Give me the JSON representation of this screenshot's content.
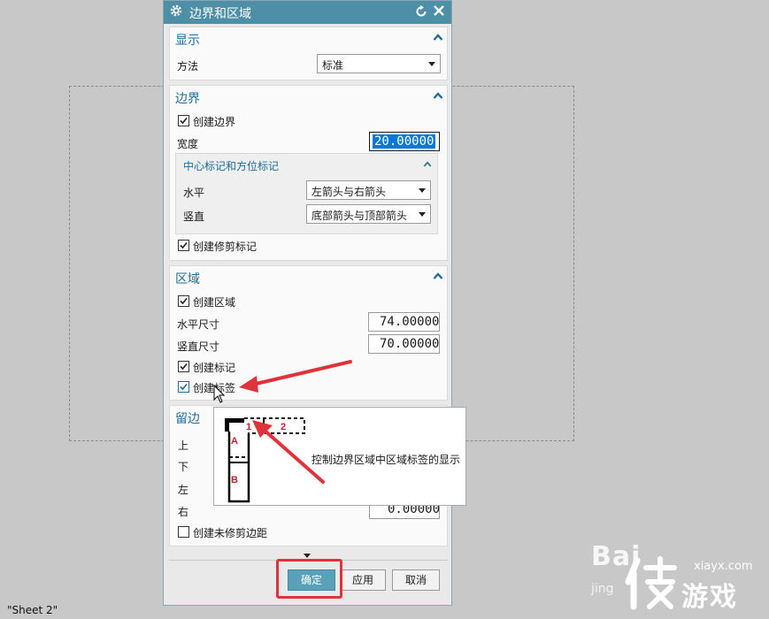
{
  "sheet": {
    "label": "\"Sheet 2\""
  },
  "dialog": {
    "title": "边界和区域",
    "icons": {
      "gear": "gear-icon",
      "reset": "reset-icon",
      "close": "close-icon"
    },
    "display": {
      "title": "显示",
      "method_label": "方法",
      "method_value": "标准"
    },
    "border": {
      "title": "边界",
      "create_border_label": "创建边界",
      "create_border_checked": true,
      "width_label": "宽度",
      "width_value": "20.00000",
      "markers": {
        "title": "中心标记和方位标记",
        "horizontal_label": "水平",
        "horizontal_value": "左箭头与右箭头",
        "vertical_label": "竖直",
        "vertical_value": "底部箭头与顶部箭头"
      },
      "create_trim_label": "创建修剪标记",
      "create_trim_checked": true
    },
    "zones": {
      "title": "区域",
      "create_zones_label": "创建区域",
      "create_zones_checked": true,
      "horizontal_size_label": "水平尺寸",
      "horizontal_size_value": "74.00000",
      "vertical_size_label": "竖直尺寸",
      "vertical_size_value": "70.00000",
      "create_marks_label": "创建标记",
      "create_marks_checked": true,
      "create_labels_label": "创建标签",
      "create_labels_checked": true
    },
    "margins": {
      "title": "留边",
      "top_label": "上",
      "bottom_label": "下",
      "left_label": "左",
      "right_label": "右",
      "right_value": "0.00000",
      "untrimmed_label": "创建未修剪边距",
      "untrimmed_checked": false
    },
    "buttons": {
      "ok": "确定",
      "apply": "应用",
      "cancel": "取消"
    }
  },
  "tooltip": {
    "text": "控制边界区域中区域标签的显示",
    "figure_labels": {
      "a": "A",
      "b": "B",
      "one": "1",
      "two": "2"
    }
  },
  "watermark": {
    "baidu": "Bai",
    "jingyan": "jing",
    "site": "xiayx.com",
    "brand": "游戏"
  },
  "colors": {
    "titlebar": "#4e8fa8",
    "section_title": "#1c6e9a",
    "annotation_red": "#e0323a",
    "selection": "#0078d7"
  }
}
